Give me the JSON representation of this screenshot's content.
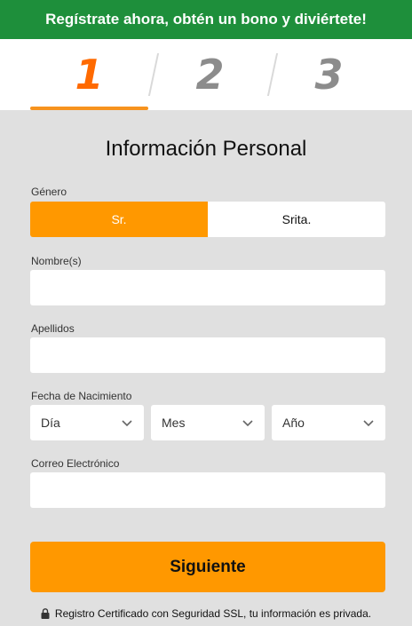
{
  "banner": {
    "text": "Regístrate ahora, obtén un bono y diviértete!"
  },
  "steps": [
    {
      "number": "1",
      "active": true
    },
    {
      "number": "2",
      "active": false
    },
    {
      "number": "3",
      "active": false
    }
  ],
  "form": {
    "title": "Información Personal",
    "gender": {
      "label": "Género",
      "options": [
        "Sr.",
        "Srita."
      ],
      "selected": "Sr."
    },
    "first_name": {
      "label": "Nombre(s)",
      "value": ""
    },
    "last_name": {
      "label": "Apellidos",
      "value": ""
    },
    "birth_date": {
      "label": "Fecha de Nacimiento",
      "day": "Día",
      "month": "Mes",
      "year": "Año"
    },
    "email": {
      "label": "Correo Electrónico",
      "value": ""
    },
    "submit_label": "Siguiente"
  },
  "footer": {
    "ssl_text": "Registro Certificado con Seguridad SSL, tu información es privada."
  },
  "colors": {
    "banner": "#1e8f3b",
    "accent": "#ff9800",
    "active_step": "#ff6a00",
    "inactive_step": "#8c8c8c"
  }
}
